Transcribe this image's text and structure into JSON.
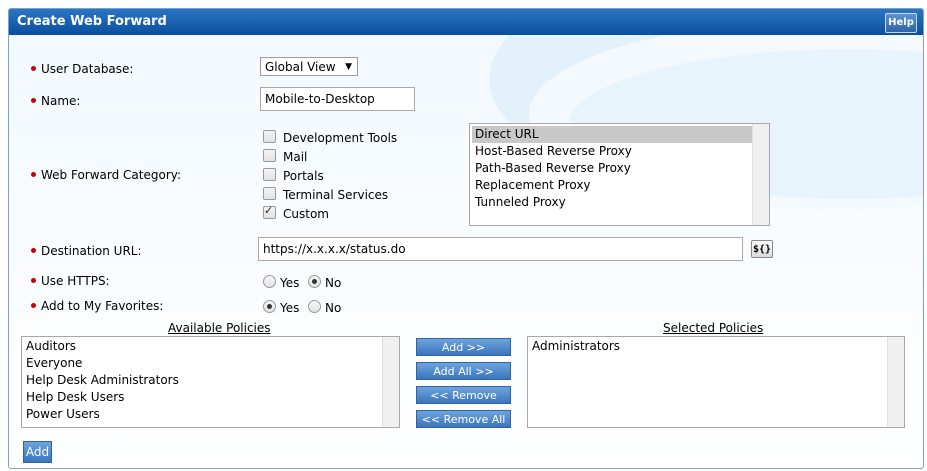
{
  "window": {
    "title": "Create Web Forward",
    "help_label": "Help"
  },
  "form": {
    "user_database": {
      "label": "User Database:",
      "value": "Global View"
    },
    "name": {
      "label": "Name:",
      "value": "Mobile-to-Desktop"
    },
    "category": {
      "label": "Web Forward Category:",
      "checkboxes": [
        {
          "label": "Development Tools",
          "checked": false
        },
        {
          "label": "Mail",
          "checked": false
        },
        {
          "label": "Portals",
          "checked": false
        },
        {
          "label": "Terminal Services",
          "checked": false
        },
        {
          "label": "Custom",
          "checked": true
        }
      ],
      "types": [
        "Direct URL",
        "Host-Based Reverse Proxy",
        "Path-Based Reverse Proxy",
        "Replacement Proxy",
        "Tunneled Proxy"
      ],
      "selected_type": "Direct URL"
    },
    "destination_url": {
      "label": "Destination URL:",
      "value": "https://x.x.x.x/status.do",
      "var_button": "${}"
    },
    "use_https": {
      "label": "Use HTTPS:",
      "yes": "Yes",
      "no": "No",
      "selected": "No"
    },
    "favorites": {
      "label": "Add to My Favorites:",
      "yes": "Yes",
      "no": "No",
      "selected": "Yes"
    }
  },
  "policies": {
    "available_title": "Available Policies",
    "selected_title": "Selected Policies",
    "available": [
      "Auditors",
      "Everyone",
      "Help Desk Administrators",
      "Help Desk Users",
      "Power Users"
    ],
    "selected": [
      "Administrators"
    ],
    "buttons": {
      "add": "Add >>",
      "add_all": "Add All >>",
      "remove": "<< Remove",
      "remove_all": "<< Remove All"
    }
  },
  "footer": {
    "add_label": "Add"
  }
}
